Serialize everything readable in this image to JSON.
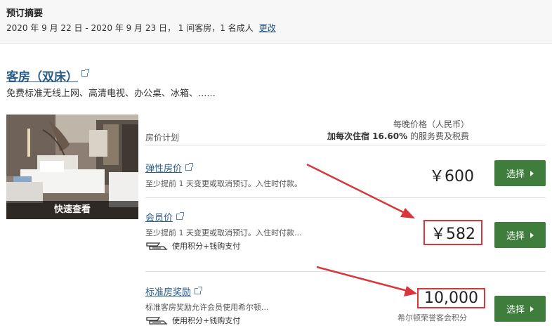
{
  "booking_summary": {
    "title": "预订摘要",
    "details": "2020 年 9 月 22 日 - 2020 年 9 月 23 日， 1 间客房，1 名成人",
    "change_link": "更改"
  },
  "room": {
    "title": "客房（双床）",
    "amenities": "免费标准无线上网、高清电视、办公桌、冰箱、......",
    "quick_view": "快速查看"
  },
  "rate_table": {
    "plan_header": "房价计划",
    "per_night_label": "每晚价格（人民币）",
    "fee_prefix": "加每次住宿 16.60%",
    "fee_suffix": " 的服务费及税费"
  },
  "rates": [
    {
      "name": "弹性房价",
      "description": "至少提前 1 天变更或取消预订。入住时付款。",
      "price": "￥600",
      "button": "选择"
    },
    {
      "name": "会员价",
      "description": "至少提前 1 天变更或取消预订。入住时付款...",
      "payment_option": "使用积分+钱购支付",
      "price": "￥582",
      "button": "选择"
    },
    {
      "name": "标准房奖励",
      "description": "标准客房奖励允许会员使用希尔顿...",
      "payment_option": "使用积分+钱购支付",
      "price": "10,000",
      "price_note": "希尔顿荣誉客会积分",
      "button": "选择"
    }
  ],
  "colors": {
    "link_blue": "#2a5c8a",
    "select_green": "#3e7d3b",
    "annotation_red": "#d8363a"
  }
}
